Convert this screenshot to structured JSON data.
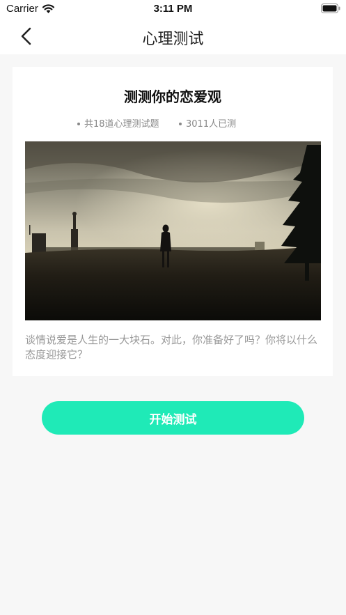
{
  "status_bar": {
    "carrier": "Carrier",
    "time": "3:11 PM"
  },
  "nav": {
    "title": "心理测试",
    "back_icon": "chevron-left-icon"
  },
  "test": {
    "title": "测测你的恋爱观",
    "question_count": "共18道心理测试题",
    "participants": "3011人已测",
    "description": "谈情说爱是人生的一大块石。对此，你准备好了吗？你将以什么态度迎接它？",
    "cover_image": "person-standing-on-field-at-dusk"
  },
  "actions": {
    "start_label": "开始测试"
  },
  "colors": {
    "accent": "#1feab7",
    "background": "#f7f7f7",
    "muted_text": "#999999"
  }
}
